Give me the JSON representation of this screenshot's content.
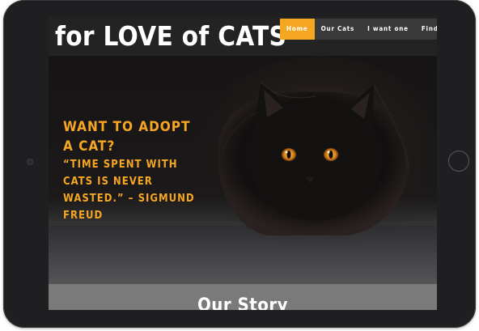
{
  "site": {
    "brand": "for LOVE of CATS"
  },
  "nav": {
    "items": [
      {
        "label": "Home",
        "active": true
      },
      {
        "label": "Our Cats",
        "active": false
      },
      {
        "label": "I want one",
        "active": false
      },
      {
        "label": "Find Us",
        "active": false
      }
    ]
  },
  "hero": {
    "title": "WANT TO ADOPT A CAT?",
    "quote": "“TIME SPENT WITH CATS IS NEVER WASTED.” – SIGMUND FREUD"
  },
  "story": {
    "title": "Our Story"
  },
  "colors": {
    "accent": "#f5a623",
    "navbar": "#232323",
    "tablet_frame": "#1f1f21",
    "story_band": "#7a7a7a"
  },
  "icons": {
    "tablet_camera": "camera-icon",
    "tablet_home": "home-button-icon"
  }
}
